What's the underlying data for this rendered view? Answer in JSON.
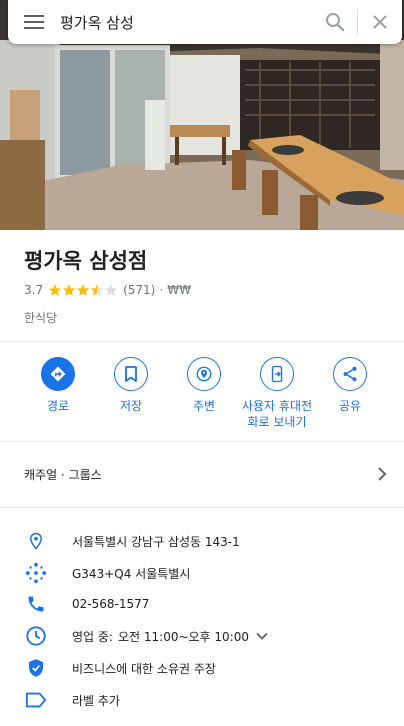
{
  "search": {
    "query": "평가옥 삼성"
  },
  "place": {
    "name": "평가옥 삼성점",
    "rating": "3.7",
    "stars": 3.5,
    "review_count": "(571)",
    "separator": "·",
    "price": "₩₩",
    "category": "한식당"
  },
  "actions": [
    {
      "label": "경로",
      "icon": "directions-icon"
    },
    {
      "label": "저장",
      "icon": "bookmark-icon"
    },
    {
      "label": "주변",
      "icon": "nearby-icon"
    },
    {
      "label": "사용자 휴대전화로 보내기",
      "label_line1": "사용자 휴대전",
      "label_line2": "화로 보내기",
      "icon": "send-to-phone-icon"
    },
    {
      "label": "공유",
      "icon": "share-icon"
    }
  ],
  "tags": {
    "text": "캐주얼 · 그룹스"
  },
  "info": {
    "address": "서울특별시 강남구 삼성동 143-1",
    "plus_code": "G343+Q4 서울특별시",
    "phone": "02-568-1577",
    "hours_status": "영업 중:",
    "hours": "오전 11:00~오후 10:00",
    "claim": "비즈니스에 대한 소유권 주장",
    "label": "라벨 추가"
  },
  "colors": {
    "accent": "#1a73e8",
    "star": "#fbbc04",
    "text_secondary": "#70757a"
  }
}
